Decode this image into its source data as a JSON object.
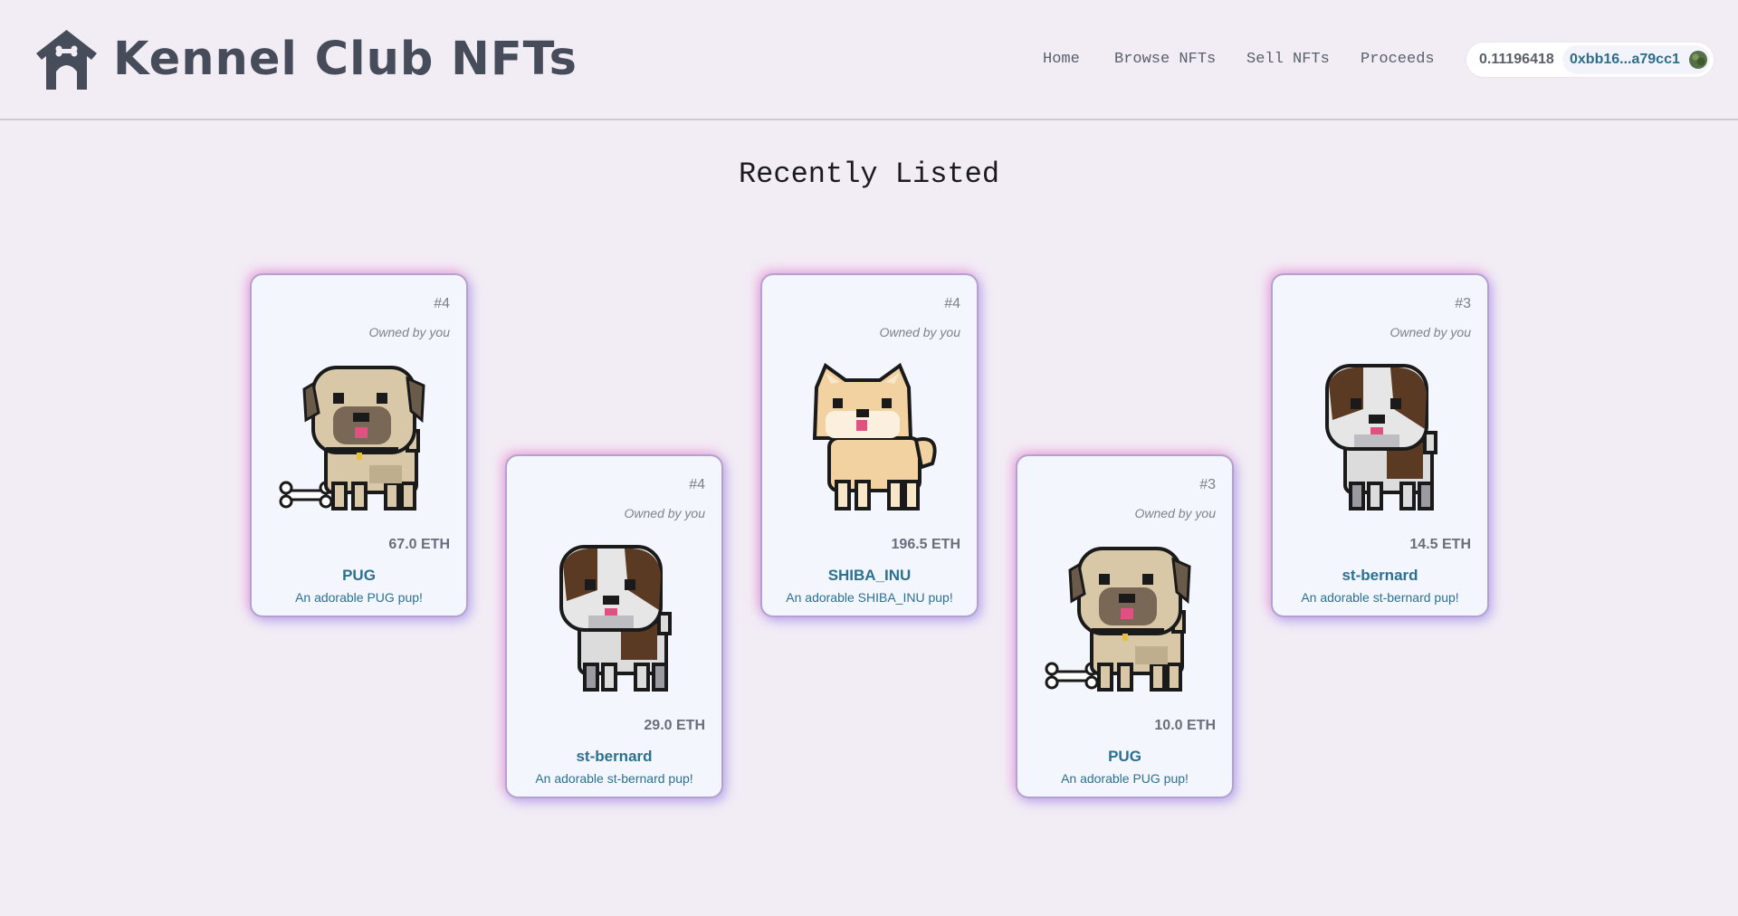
{
  "header": {
    "brand": "Kennel Club NFTs",
    "logo_icon": "dog-house-icon",
    "nav": [
      "Home",
      "Browse NFTs",
      "Sell NFTs",
      "Proceeds"
    ],
    "wallet": {
      "balance": "0.11196418",
      "address": "0xbb16...a79cc1",
      "avatar_icon": "identicon-avatar"
    }
  },
  "main": {
    "title": "Recently Listed",
    "cards": [
      {
        "id": "#4",
        "owner": "Owned by you",
        "price": "67.0 ETH",
        "name": "PUG",
        "desc": "An adorable PUG pup!",
        "breed": "pug"
      },
      {
        "id": "#4",
        "owner": "Owned by you",
        "price": "29.0 ETH",
        "name": "st-bernard",
        "desc": "An adorable st-bernard pup!",
        "breed": "st-bernard"
      },
      {
        "id": "#4",
        "owner": "Owned by you",
        "price": "196.5 ETH",
        "name": "SHIBA_INU",
        "desc": "An adorable SHIBA_INU pup!",
        "breed": "shiba-inu"
      },
      {
        "id": "#3",
        "owner": "Owned by you",
        "price": "10.0 ETH",
        "name": "PUG",
        "desc": "An adorable PUG pup!",
        "breed": "pug"
      },
      {
        "id": "#3",
        "owner": "Owned by you",
        "price": "14.5 ETH",
        "name": "st-bernard",
        "desc": "An adorable st-bernard pup!",
        "breed": "st-bernard"
      }
    ]
  },
  "colors": {
    "background": "#f2ecf5",
    "brand_text": "#464c5a",
    "card_bg": "#f4f6fd",
    "link": "#2b7093"
  }
}
